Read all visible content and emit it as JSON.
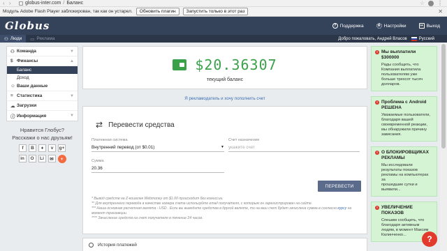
{
  "browser": {
    "url_domain": "globus-inter.com",
    "url_separator": "/",
    "page_title": "Баланс"
  },
  "flash": {
    "message": "Модуль Adobe Flash Player заблокирован, так как он устарел.",
    "update_button": "Обновить плагин",
    "run_once_button": "Запустить только в этот раз"
  },
  "header": {
    "logo": "Globus",
    "actions": [
      {
        "label": "Поддержка",
        "icon": "help-circle-icon"
      },
      {
        "label": "Настройки",
        "icon": "gear-icon"
      },
      {
        "label": "Выход",
        "icon": "logout-icon"
      }
    ]
  },
  "subnav": {
    "tabs": [
      {
        "label": "Люди",
        "active": true
      },
      {
        "label": "Реклама",
        "active": false
      }
    ],
    "welcome": "Добро пожаловать, Андрей Власов",
    "language": "Русский"
  },
  "sidebar": {
    "items": [
      {
        "label": "Команда",
        "icon": "team-icon",
        "chevron": "▼"
      },
      {
        "label": "Финансы",
        "icon": "dollar-icon",
        "chevron": "▲"
      },
      {
        "label": "Ваши данные",
        "icon": "user-icon"
      },
      {
        "label": "Статистика",
        "icon": "stats-icon",
        "chevron": "▼"
      },
      {
        "label": "Загрузки",
        "icon": "cloud-icon"
      },
      {
        "label": "Информация",
        "icon": "info-icon",
        "chevron": "▼"
      }
    ],
    "finance_sub": [
      "Баланс",
      "Доход"
    ]
  },
  "likebox": {
    "line1": "Нравится Глобус?",
    "line2": "Расскажи о нас друзьям!",
    "buttons": [
      "f",
      "B",
      "♦",
      "v",
      "g+",
      "in",
      "O",
      "Li",
      "✉",
      "+"
    ]
  },
  "balance": {
    "amount": "$20.36307",
    "label": "текущий баланс",
    "ad_link": "Я рекламодатель и хочу пополнить счет"
  },
  "transfer": {
    "title": "Перевести средства",
    "payment_system_label": "Платежная система",
    "payment_system_value": "Внутренний перевод (от $0.01)",
    "account_label": "Счет назначения",
    "account_placeholder": "укажите счет",
    "amount_label": "Сумма",
    "amount_value": "20.36",
    "button": "ПЕРЕВЕСТИ",
    "note1": "* Вывод средств на Z-кошелек Webmoney от $1.00 происходит без комиссии.",
    "note2": "** Для внутреннего перевода в качестве номера счета используйте email получателя, с которым он зарегистрирован на сайте.",
    "note3a": "*** Наша основная расчетная валюта - USD . Если вы выводите средства в другой валюте, то на ваш счет будет зачислена сумма в согласно ",
    "note3_link": "курсу",
    "note3b": " на момент транзакции.",
    "note4": "**** Зачисление средств на счет получателя в течение 24 часов."
  },
  "history": {
    "title": "История платежей"
  },
  "news": [
    {
      "title": "Мы выплатили $300000",
      "body": [
        "Рады сообщить, что",
        "Компания выплатила",
        "пользователям уже",
        "больше трехсот тысяч",
        "долларов."
      ]
    },
    {
      "title": "Проблема с Android РЕШЕНА",
      "body": [
        "Уважаемые пользователи,",
        "благодаря вашей",
        "своевременной реакции,",
        "мы обнаружили причину",
        "зависания."
      ]
    },
    {
      "title": "О БЛОКИРОВЩИКАХ РЕКЛАМЫ",
      "body": [
        "Мы исследовали",
        "результаты показов",
        "рекламы на компьютерах за",
        "прошедшие сутки и",
        "выявили..."
      ]
    },
    {
      "title": "УВЕЛИЧЕНИЕ ПОКАЗОВ",
      "body": [
        "Спешим сообщить, что",
        "благодаря активным",
        "людям, в момент Максим",
        "Калинченко..."
      ]
    }
  ],
  "help_button": "?"
}
